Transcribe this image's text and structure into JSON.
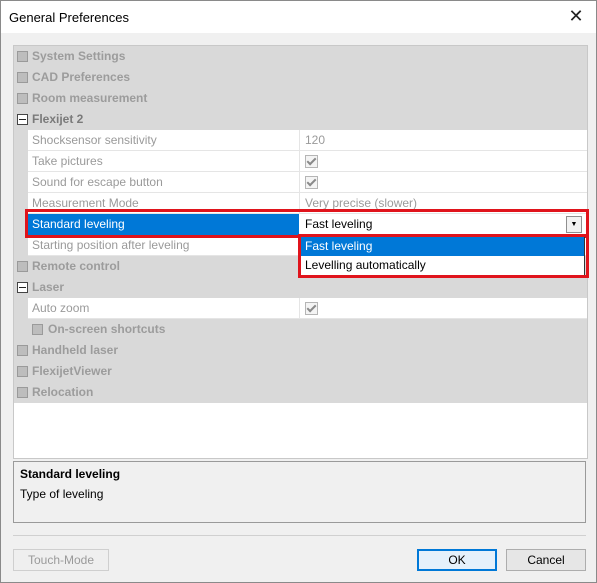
{
  "window": {
    "title": "General Preferences",
    "close_glyph": "✕"
  },
  "grid": {
    "categories_top": [
      {
        "label": "System Settings"
      },
      {
        "label": "CAD Preferences"
      },
      {
        "label": "Room measurement"
      }
    ],
    "flexijet": {
      "label": "Flexijet 2",
      "properties": [
        {
          "name": "Shocksensor sensitivity",
          "value": "120"
        },
        {
          "name": "Take pictures",
          "checked": true
        },
        {
          "name": "Sound for escape button",
          "checked": true
        },
        {
          "name": "Measurement Mode",
          "value": "Very precise (slower)"
        }
      ],
      "selected": {
        "name": "Standard leveling",
        "value": "Fast leveling"
      },
      "after": {
        "name": "Starting position after leveling"
      }
    },
    "remote": {
      "label": "Remote control"
    },
    "laser": {
      "label": "Laser",
      "auto_zoom": {
        "name": "Auto zoom",
        "checked": true
      },
      "shortcuts": {
        "label": "On-screen shortcuts"
      }
    },
    "categories_bottom": [
      {
        "label": "Handheld laser"
      },
      {
        "label": "FlexijetViewer"
      },
      {
        "label": "Relocation"
      }
    ]
  },
  "dropdown": {
    "options": [
      "Fast leveling",
      "Levelling automatically"
    ],
    "selected_index": 0
  },
  "description": {
    "title": "Standard leveling",
    "text": "Type of leveling"
  },
  "buttons": {
    "touch_mode": "Touch-Mode",
    "ok": "OK",
    "cancel": "Cancel"
  },
  "colors": {
    "selection": "#0078d7",
    "annotation": "#e0141c"
  }
}
